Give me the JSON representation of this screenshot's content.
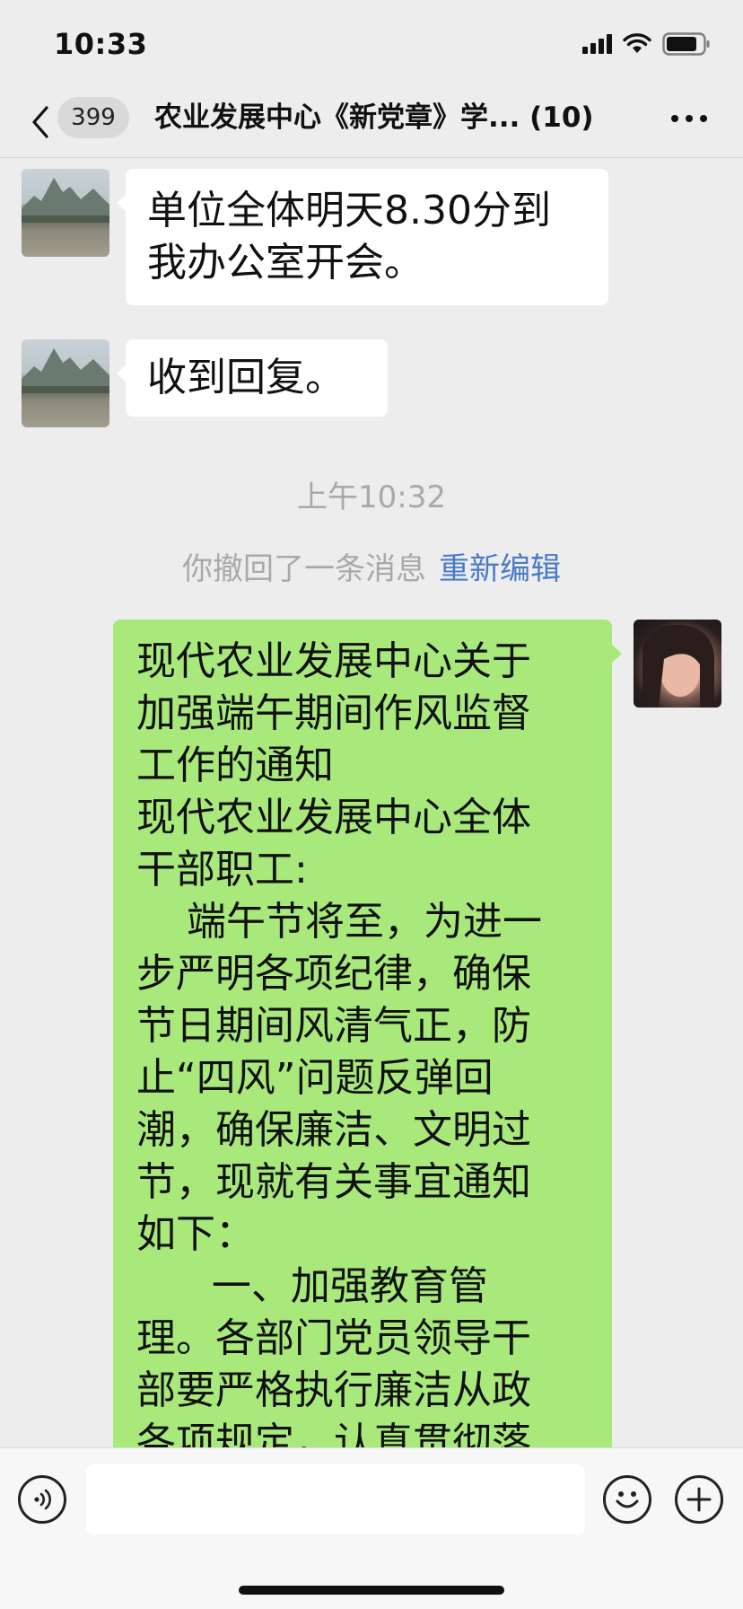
{
  "status_bar": {
    "time": "10:33"
  },
  "nav": {
    "unread_count": "399",
    "title": "农业发展中心《新党章》学... (10)"
  },
  "messages": [
    {
      "sender": "other",
      "avatar": "landscape-avatar",
      "text": "单位全体明天8.30分到\n我办公室开会。"
    },
    {
      "sender": "other",
      "avatar": "landscape-avatar",
      "text": "收到回复。"
    },
    {
      "type": "timestamp",
      "text": "上午10:32"
    },
    {
      "type": "recall",
      "text": "你撤回了一条消息",
      "action": "重新编辑"
    },
    {
      "sender": "self",
      "avatar": "portrait-avatar",
      "text": "现代农业发展中心关于\n加强端午期间作风监督\n工作的通知\n现代农业发展中心全体\n干部职工:\n    端午节将至，为进一\n步严明各项纪律，确保\n节日期间风清气正，防\n止“四风”问题反弹回\n潮，确保廉洁、文明过\n节，现就有关事宜通知\n如下：\n      一、加强教育管\n理。各部门党员领导干\n部要严格执行廉洁从政\n各项规定，认真贯彻落"
    }
  ],
  "input_bar": {
    "value": ""
  },
  "colors": {
    "background": "#ededed",
    "self_bubble": "#a9e97b",
    "other_bubble": "#ffffff",
    "link": "#4a7ac7",
    "muted_text": "#a9a9a9"
  }
}
